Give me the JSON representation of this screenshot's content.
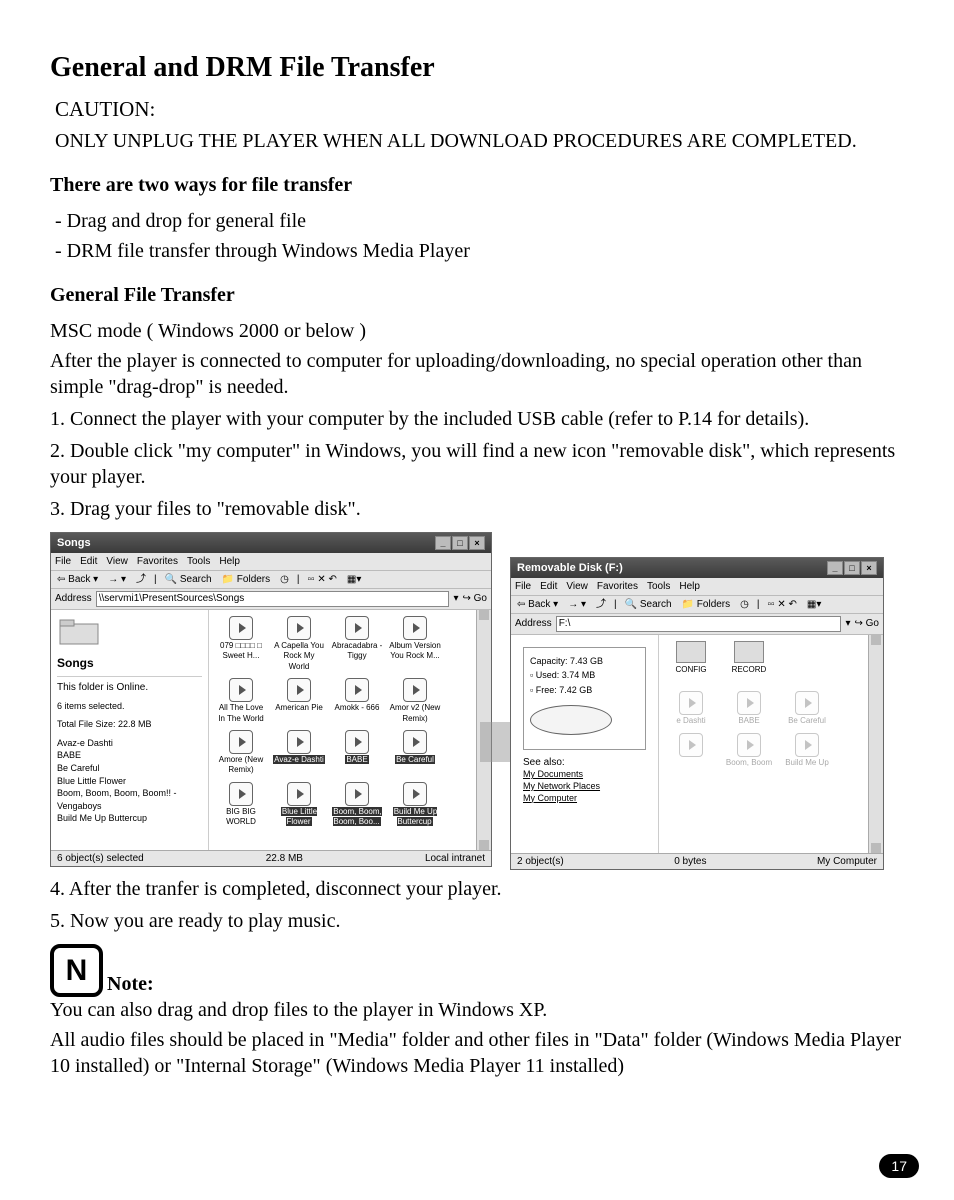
{
  "title": "General and DRM File Transfer",
  "caution_label": "CAUTION:",
  "caution_text": "ONLY UNPLUG THE PLAYER WHEN ALL DOWNLOAD PROCEDURES ARE COMPLETED.",
  "two_ways_heading": "There are two ways for file transfer",
  "two_ways": [
    "- Drag and drop for general file",
    "- DRM file transfer through Windows Media Player"
  ],
  "general_heading": "General File Transfer",
  "msc_line": "MSC mode ( Windows 2000 or below )",
  "msc_desc": "After the player is connected to computer for uploading/downloading, no special operation other than simple \"drag-drop\" is needed.",
  "steps": [
    "1. Connect the player with your computer by the included USB cable (refer to P.14 for details).",
    "2. Double click \"my computer\" in Windows, you will find a new icon \"removable disk\", which represents your player.",
    "3. Drag your files to \"removable disk\".",
    "4. After the tranfer is completed, disconnect your player.",
    "5. Now you are ready to play music."
  ],
  "note_label": "Note:",
  "note_text1": "You can also drag and drop files to the player in Windows XP.",
  "note_text2": "All audio files should be placed in \"Media\" folder and other files in \"Data\" folder (Windows Media Player 10 installed) or \"Internal Storage\" (Windows Media Player 11 installed)",
  "page_number": "17",
  "win1": {
    "title": "Songs",
    "menu": [
      "File",
      "Edit",
      "View",
      "Favorites",
      "Tools",
      "Help"
    ],
    "toolbar": {
      "back": "Back",
      "search": "Search",
      "folders": "Folders"
    },
    "address_label": "Address",
    "address_value": "\\\\servmi1\\PresentSources\\Songs",
    "go": "Go",
    "side": {
      "heading": "Songs",
      "online": "This folder is Online.",
      "sel_count": "6 items selected.",
      "size": "Total File Size: 22.8 MB",
      "list": [
        "Avaz-e Dashti",
        "BABE",
        "Be Careful",
        "Blue Little Flower",
        "Boom, Boom, Boom, Boom!! - Vengaboys",
        "Build Me Up Buttercup"
      ]
    },
    "files_row1": [
      "079 □□□□ □ Sweet H...",
      "A Capella You Rock My World",
      "Abracadabra - Tiggy",
      "Album Version You Rock M..."
    ],
    "files_row2": [
      "All The Love In The World",
      "American Pie",
      "Amokk - 666",
      "Amor v2 (New Remix)"
    ],
    "files_row3": [
      "Amore (New Remix)",
      "Avaz-e Dashti",
      "BABE",
      "Be Careful"
    ],
    "files_row4": [
      "BIG BIG WORLD",
      "Blue Little Flower",
      "Boom, Boom, Boom, Boo...",
      "Build Me Up Buttercup"
    ],
    "status_left": "6 object(s) selected",
    "status_mid": "22.8 MB",
    "status_right": "Local intranet"
  },
  "win2": {
    "title": "Removable Disk (F:)",
    "menu": [
      "File",
      "Edit",
      "View",
      "Favorites",
      "Tools",
      "Help"
    ],
    "toolbar": {
      "back": "Back",
      "search": "Search",
      "folders": "Folders"
    },
    "address_label": "Address",
    "address_value": "F:\\",
    "go": "Go",
    "cap": {
      "capacity": "Capacity: 7.43 GB",
      "used": "Used: 3.74 MB",
      "free": "Free: 7.42 GB"
    },
    "seealso_label": "See also:",
    "seealso": [
      "My Documents",
      "My Network Places",
      "My Computer"
    ],
    "folders": [
      "CONFIG",
      "RECORD"
    ],
    "ghosts": [
      "e Dashti",
      "BABE",
      "Be Careful",
      "",
      "Boom, Boom",
      "Build Me Up"
    ],
    "status_left": "2 object(s)",
    "status_mid": "0 bytes",
    "status_right": "My Computer"
  }
}
